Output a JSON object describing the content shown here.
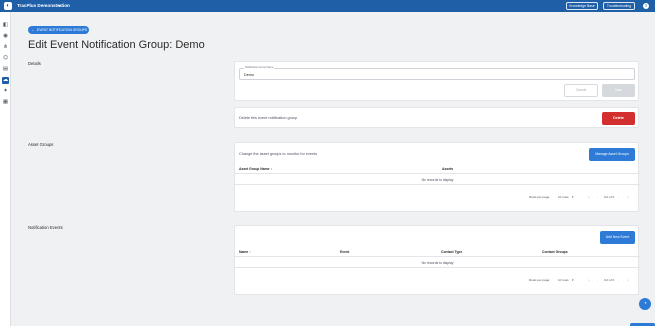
{
  "header": {
    "logo_glyph": "◐",
    "org_name": "TracPlus Demonstration",
    "org_chevron": "▾",
    "knowledge_base_label": "Knowledge Base",
    "troubleshooting_label": "Troubleshooting",
    "help_glyph": "?",
    "bar_color": "#1f5fa8"
  },
  "sidebar": {
    "items": [
      {
        "icon": "map-icon",
        "glyph": "◧",
        "active": false
      },
      {
        "icon": "chat-icon",
        "glyph": "◉",
        "active": false
      },
      {
        "icon": "share-icon",
        "glyph": "⋔",
        "active": false
      },
      {
        "icon": "network-icon",
        "glyph": "⌬",
        "active": false
      },
      {
        "icon": "document-icon",
        "glyph": "▤",
        "active": false
      },
      {
        "icon": "cloud-icon",
        "glyph": "☁",
        "active": true
      },
      {
        "icon": "settings-icon",
        "glyph": "✦",
        "active": false
      },
      {
        "icon": "grid-icon",
        "glyph": "▦",
        "active": false
      }
    ]
  },
  "page": {
    "back_label": "EVENT NOTIFICATION GROUPS",
    "back_arrow": "←",
    "title": "Edit Event Notification Group: Demo"
  },
  "details": {
    "section_label": "Details",
    "name_field_label": "Notification Group Name",
    "name_value": "Demo",
    "cancel_label": "Cancel",
    "save_label": "Save",
    "delete_text": "Delete this event notification group",
    "delete_label": "Delete"
  },
  "asset_groups": {
    "section_label": "Asset Groups",
    "description": "Change the asset groups to monitor for events",
    "manage_label": "Manage Asset Groups",
    "columns": [
      "Asset Group Name",
      "Assets"
    ],
    "sort_glyph": "↑",
    "empty_text": "No records to display",
    "rows_per_page_label": "Rows per page:",
    "rows_value": "10 rows",
    "pagination": {
      "first": "|‹",
      "prev": "‹",
      "range": "0-0 of 0",
      "next": "›",
      "last": "›|"
    }
  },
  "notification_events": {
    "section_label": "Notification Events",
    "add_label": "Add New Event",
    "columns": [
      "Name",
      "Event",
      "Contact Type",
      "Contact Groups"
    ],
    "sort_glyph": "↑",
    "empty_text": "No records to display",
    "rows_per_page_label": "Rows per page:",
    "rows_value": "10 rows",
    "pagination": {
      "first": "|‹",
      "prev": "‹",
      "range": "0-0 of 0",
      "next": "›",
      "last": "›|"
    }
  },
  "chat": {
    "glyph": "◔"
  }
}
